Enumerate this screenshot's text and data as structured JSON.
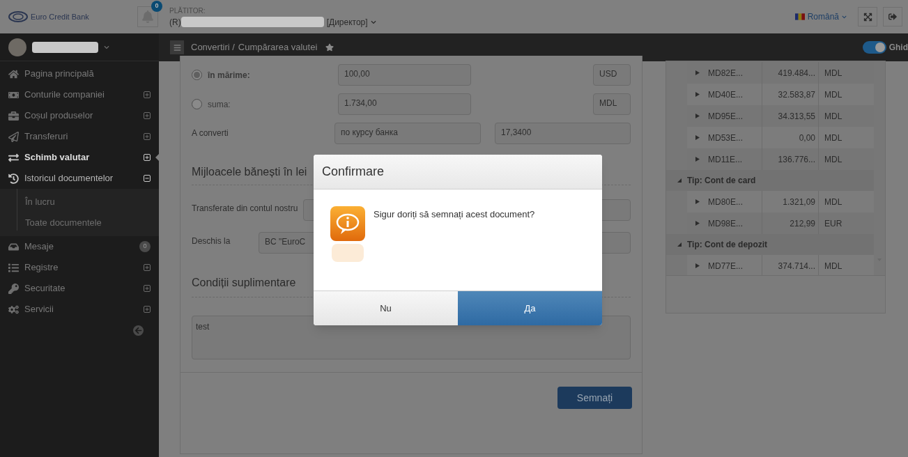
{
  "header": {
    "logo_text": "Euro Credit Bank",
    "notification_count": "0",
    "payer_label": "PLĂTITOR:",
    "payer_prefix": "(R)",
    "payer_role": "[Директор]",
    "language": "Română"
  },
  "breadcrumb": {
    "items": [
      "Convertiri /",
      "Cumpărarea valutei"
    ],
    "guide": {
      "label": "Ghid",
      "on": true
    }
  },
  "sidebar": {
    "items": [
      {
        "label": "Pagina principală",
        "selected": false
      },
      {
        "label": "Conturile companiei",
        "selected": false,
        "expanded": false
      },
      {
        "label": "Coșul produselor",
        "selected": false,
        "expanded": false
      },
      {
        "label": "Transferuri",
        "selected": false,
        "expanded": false
      },
      {
        "label": "Schimb valutar",
        "selected": true,
        "expanded": false
      },
      {
        "label": "Istoricul documentelor",
        "selected": false,
        "expanded": true,
        "children": [
          {
            "label": "În lucru",
            "selected": false
          },
          {
            "label": "Toate documentele",
            "selected": false
          }
        ]
      },
      {
        "label": "Mesaje",
        "selected": false,
        "badge": "0"
      },
      {
        "label": "Registre",
        "selected": false,
        "expanded": false
      },
      {
        "label": "Securitate",
        "selected": false,
        "expanded": false
      },
      {
        "label": "Servicii",
        "selected": false,
        "expanded": false
      }
    ]
  },
  "form": {
    "amount_options": [
      {
        "label": "în mărime:",
        "selected": true,
        "value": "100,00",
        "currency": "USD"
      },
      {
        "label": "suma:",
        "selected": false,
        "value": "1.734,00",
        "currency": "MDL"
      }
    ],
    "convert": {
      "label": "A converti",
      "rate_type": "по курсу банка",
      "rate": "17,3400"
    },
    "funds_section": {
      "title": "Mijloacele bănești în lei",
      "fields": [
        {
          "label": "Transferate din contul nostru"
        },
        {
          "label": "Deschis la",
          "value": "BC \"EuroC"
        }
      ]
    },
    "conditions_section": {
      "title": "Condiții suplimentare",
      "text": "test"
    },
    "sign_button": "Semnați"
  },
  "accounts": {
    "rows": [
      {
        "account": "MD82E...",
        "balance": "419.484...",
        "currency": "MDL"
      },
      {
        "account": "MD40E...",
        "balance": "32.583,87",
        "currency": "MDL"
      },
      {
        "account": "MD95E...",
        "balance": "34.313,55",
        "currency": "MDL"
      },
      {
        "account": "MD53E...",
        "balance": "0,00",
        "currency": "MDL"
      },
      {
        "account": "MD11E...",
        "balance": "136.776...",
        "currency": "MDL"
      }
    ],
    "groups": [
      {
        "title": "Tip: Cont de card",
        "expanded": true,
        "rows": [
          {
            "account": "MD80E...",
            "balance": "1.321,09",
            "currency": "MDL"
          },
          {
            "account": "MD98E...",
            "balance": "212,99",
            "currency": "EUR"
          }
        ]
      },
      {
        "title": "Tip: Cont de depozit",
        "expanded": true,
        "rows": [
          {
            "account": "MD77E...",
            "balance": "374.714...",
            "currency": "MDL"
          }
        ]
      }
    ]
  },
  "dialog": {
    "title": "Confirmare",
    "message": "Sigur doriți să semnați acest document?",
    "buttons": [
      {
        "label": "Nu",
        "kind": "secondary"
      },
      {
        "label": "Да",
        "kind": "primary"
      }
    ]
  }
}
